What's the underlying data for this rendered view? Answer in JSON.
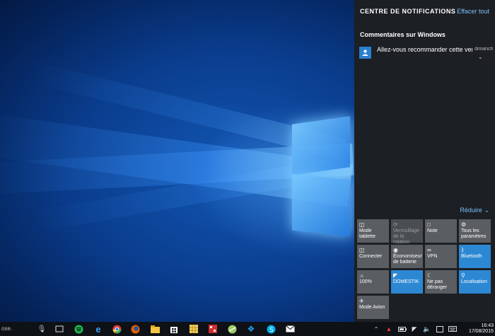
{
  "notification_center": {
    "title": "CENTRE DE NOTIFICATIONS",
    "clear_all": "Effacer tout",
    "group": "Commentaires sur Windows",
    "notification": {
      "text": "Allez-vous recommander cette versi",
      "time": "dimanch",
      "icon": "feedback-icon"
    },
    "collapse": "Réduire"
  },
  "quick_actions": [
    {
      "label": "Mode tablette",
      "icon": "tablet-icon",
      "state": "off"
    },
    {
      "label": "Verrouillage de la rotation",
      "icon": "rotation-lock-icon",
      "state": "disabled"
    },
    {
      "label": "Note",
      "icon": "note-icon",
      "state": "off"
    },
    {
      "label": "Tous les paramètres",
      "icon": "gear-icon",
      "state": "off"
    },
    {
      "label": "Connecter",
      "icon": "connect-icon",
      "state": "off"
    },
    {
      "label": "Économiseur de batterie",
      "icon": "battery-saver-icon",
      "state": "off"
    },
    {
      "label": "VPN",
      "icon": "vpn-icon",
      "state": "off"
    },
    {
      "label": "Bluetooth",
      "icon": "bluetooth-icon",
      "state": "on"
    },
    {
      "label": "100%",
      "icon": "brightness-icon",
      "state": "off"
    },
    {
      "label": "DOMESTIK",
      "icon": "wifi-icon",
      "state": "on"
    },
    {
      "label": "Ne pas déranger",
      "icon": "moon-icon",
      "state": "off"
    },
    {
      "label": "Localisation",
      "icon": "location-icon",
      "state": "on"
    },
    {
      "label": "Mode Avion",
      "icon": "airplane-icon",
      "state": "off"
    }
  ],
  "taskbar": {
    "search_text": "ose.",
    "clock_time": "16:43",
    "clock_date": "17/08/2015"
  },
  "colors": {
    "accent": "#2d88d4",
    "tile_off": "#5a5d61",
    "panel_bg": "#1c1f23",
    "link": "#7cc0ff"
  }
}
